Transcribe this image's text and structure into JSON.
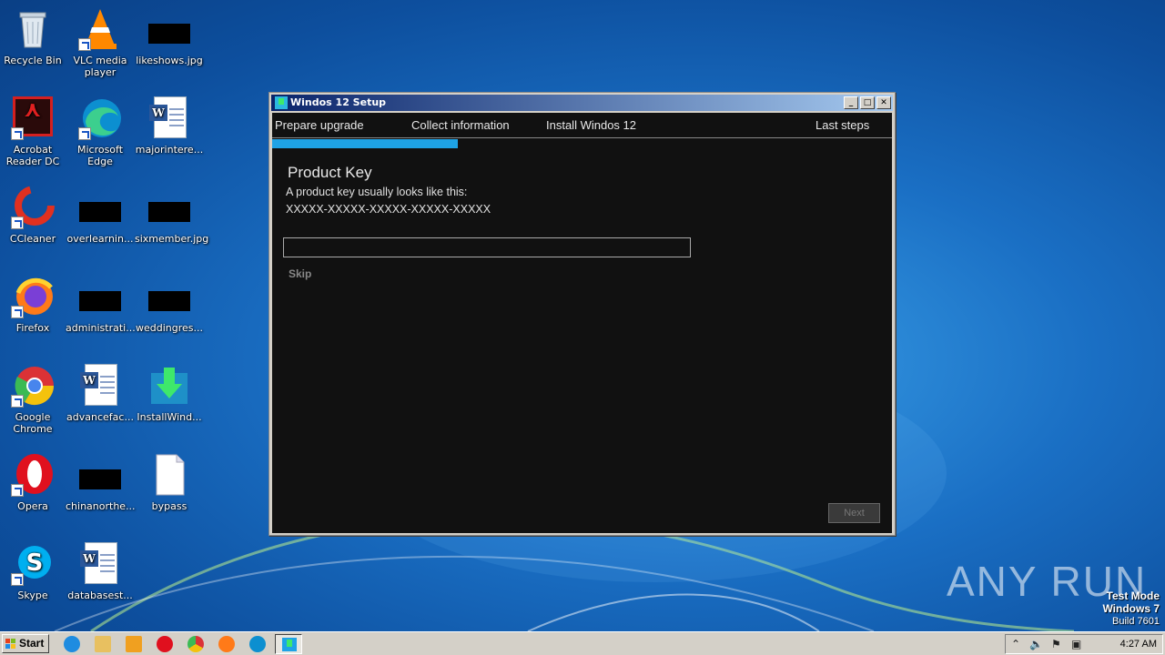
{
  "desktop": {
    "icons": [
      {
        "label": "Recycle Bin"
      },
      {
        "label": "VLC media player"
      },
      {
        "label": "likeshows.jpg"
      },
      {
        "label": "Acrobat Reader DC"
      },
      {
        "label": "Microsoft Edge"
      },
      {
        "label": "majorintere..."
      },
      {
        "label": "CCleaner"
      },
      {
        "label": "overlearnin..."
      },
      {
        "label": "sixmember.jpg"
      },
      {
        "label": "Firefox"
      },
      {
        "label": "administrati..."
      },
      {
        "label": "weddingres..."
      },
      {
        "label": "Google Chrome"
      },
      {
        "label": "advancefac..."
      },
      {
        "label": "InstallWind..."
      },
      {
        "label": "Opera"
      },
      {
        "label": "chinanorthe..."
      },
      {
        "label": "bypass"
      },
      {
        "label": "Skype"
      },
      {
        "label": "databasest..."
      }
    ]
  },
  "window": {
    "title": "Windos 12 Setup",
    "steps": [
      "Prepare upgrade",
      "Collect information",
      "Install Windos 12",
      "Last steps"
    ],
    "progress_fraction": 0.3,
    "heading": "Product Key",
    "description": "A product key usually looks like this:",
    "example": "XXXXX-XXXXX-XXXXX-XXXXX-XXXXX",
    "input_value": "",
    "skip_label": "Skip",
    "next_label": "Next"
  },
  "watermark": "ANY RUN",
  "system_info": {
    "line1": "Test Mode",
    "line2": "Windows 7",
    "line3": "Build 7601"
  },
  "taskbar": {
    "start_label": "Start",
    "clock": "4:27 AM"
  },
  "colors": {
    "accent": "#1ea3e6",
    "client_bg": "#111111"
  }
}
